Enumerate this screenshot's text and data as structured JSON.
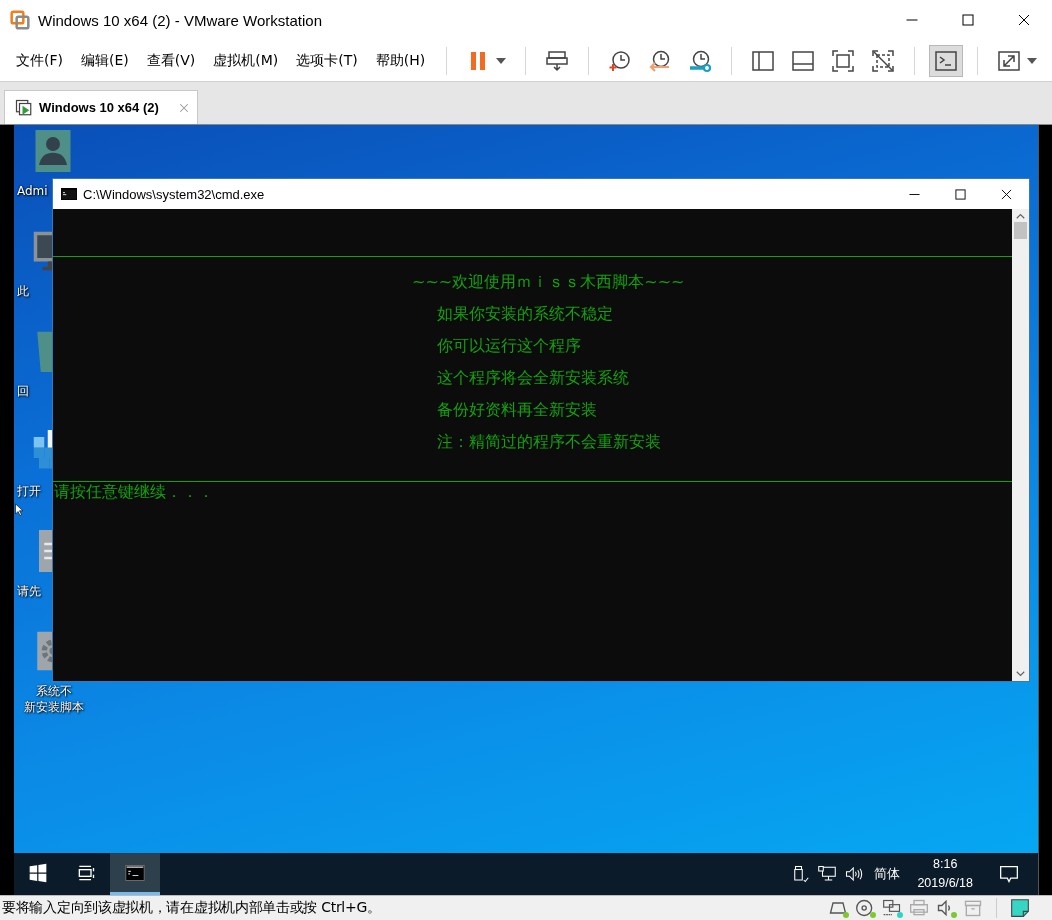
{
  "window": {
    "title": "Windows 10 x64 (2) - VMware Workstation"
  },
  "menu": [
    "文件(F)",
    "编辑(E)",
    "查看(V)",
    "虚拟机(M)",
    "选项卡(T)",
    "帮助(H)"
  ],
  "toolbar": [
    {
      "kind": "pause",
      "dropdown": true,
      "pressed": false
    },
    {
      "kind": "separator"
    },
    {
      "kind": "send-keys",
      "dropdown": false,
      "pressed": false
    },
    {
      "kind": "separator"
    },
    {
      "kind": "snapshot",
      "dropdown": false,
      "pressed": false
    },
    {
      "kind": "revert",
      "dropdown": false,
      "pressed": false
    },
    {
      "kind": "snapshot-manager",
      "dropdown": false,
      "pressed": false
    },
    {
      "kind": "separator"
    },
    {
      "kind": "library",
      "dropdown": false,
      "pressed": false
    },
    {
      "kind": "thumbnails",
      "dropdown": false,
      "pressed": false
    },
    {
      "kind": "full-screen",
      "dropdown": false,
      "pressed": false
    },
    {
      "kind": "unity",
      "dropdown": false,
      "pressed": false
    },
    {
      "kind": "separator"
    },
    {
      "kind": "console-view",
      "dropdown": false,
      "pressed": true
    },
    {
      "kind": "separator"
    },
    {
      "kind": "stretch",
      "dropdown": true,
      "pressed": false
    }
  ],
  "tabs": [
    {
      "label": "Windows 10 x64 (2)",
      "selected": true
    }
  ],
  "desktop": {
    "icons": [
      {
        "kind": "user",
        "label_lines": [
          "Admi"
        ]
      },
      {
        "kind": "computer",
        "label_lines": [
          "此"
        ]
      },
      {
        "kind": "recycle-bin",
        "label_lines": [
          "回"
        ]
      },
      {
        "kind": "registry",
        "label_lines": [
          "打开"
        ]
      },
      {
        "kind": "document",
        "label_lines": [
          "请先"
        ]
      },
      {
        "kind": "settings",
        "label_lines": [
          "系统不",
          "新安装脚本"
        ]
      }
    ]
  },
  "console": {
    "title": "C:\\Windows\\system32\\cmd.exe",
    "banner": "~~~欢迎使用ｍｉｓｓ木西脚本~~~",
    "lines": [
      "如果你安装的系统不稳定",
      "你可以运行这个程序",
      "这个程序将会全新安装系统",
      "备份好资料再全新安装",
      "注：精简过的程序不会重新安装"
    ],
    "prompt": "请按任意键继续．．．"
  },
  "taskbar": {
    "buttons": [
      {
        "kind": "start",
        "active": false
      },
      {
        "kind": "task-view",
        "active": false
      },
      {
        "kind": "console-app",
        "active": true
      }
    ],
    "tray": [
      {
        "kind": "usb"
      },
      {
        "kind": "network"
      },
      {
        "kind": "volume"
      }
    ],
    "language": "简体",
    "time": "8:16",
    "date": "2019/6/18"
  },
  "status_bar": {
    "message": "要将输入定向到该虚拟机，请在虚拟机内部单击或按 Ctrl+G。",
    "devices": [
      {
        "kind": "hard-disk",
        "connected": true,
        "color": "#7cc92d"
      },
      {
        "kind": "optical-disc",
        "connected": true,
        "color": "#7cc92d"
      },
      {
        "kind": "network",
        "connected": true,
        "color": "#2dd4c8"
      },
      {
        "kind": "printer",
        "connected": false
      },
      {
        "kind": "sound",
        "connected": true,
        "color": "#7cc92d"
      },
      {
        "kind": "archive",
        "connected": false
      },
      {
        "kind": "separator"
      },
      {
        "kind": "note",
        "connected": false
      }
    ]
  }
}
